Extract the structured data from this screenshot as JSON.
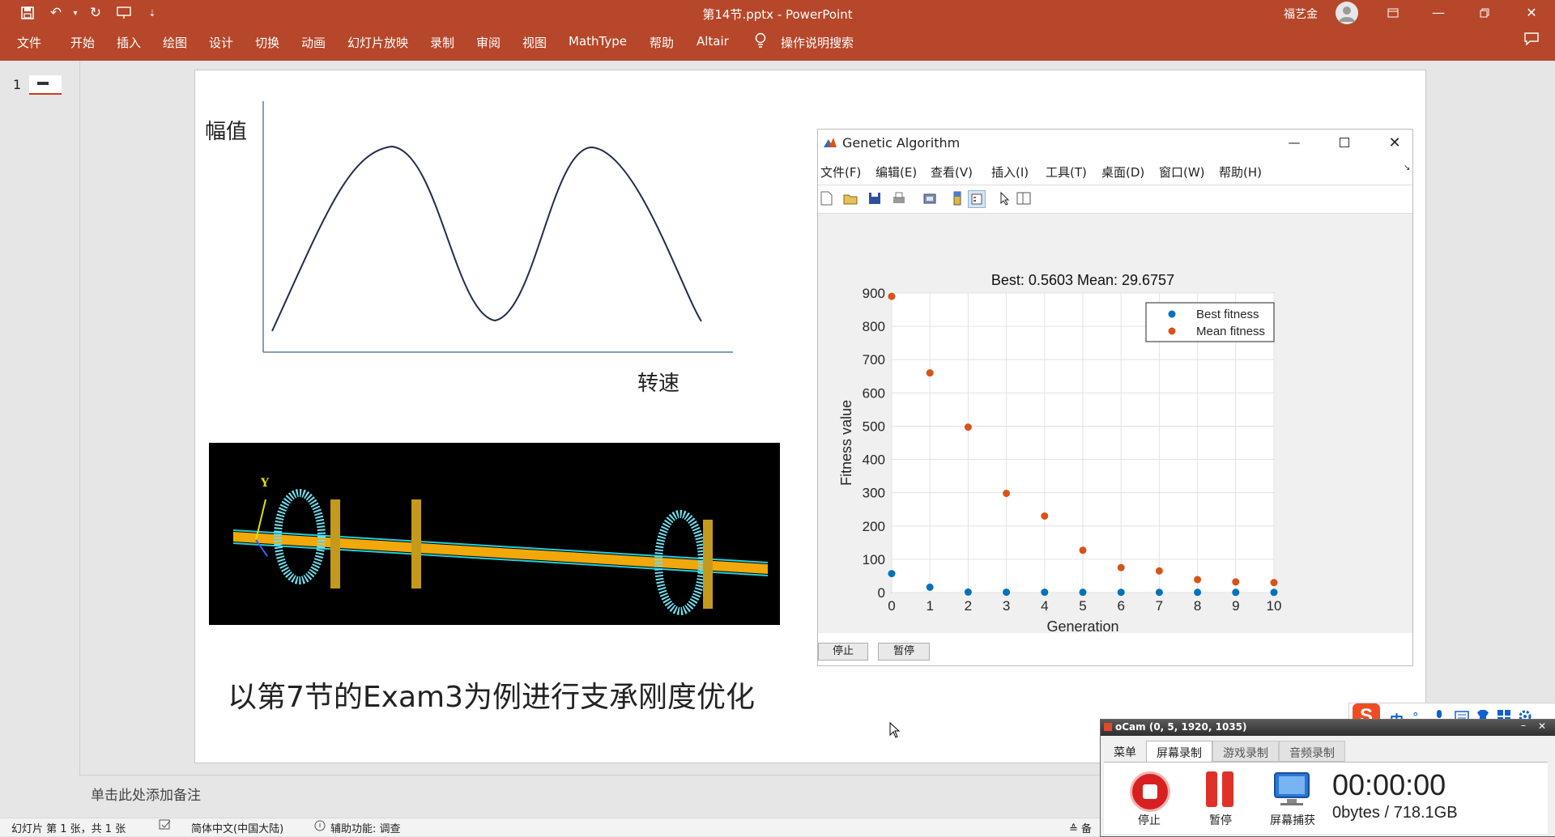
{
  "app": {
    "title": "第14节.pptx - PowerPoint",
    "user": "福艺金"
  },
  "ribbon": {
    "tabs": [
      "文件",
      "开始",
      "插入",
      "绘图",
      "设计",
      "切换",
      "动画",
      "幻灯片放映",
      "录制",
      "审阅",
      "视图",
      "MathType",
      "帮助",
      "Altair"
    ],
    "search_label": "操作说明搜索"
  },
  "thumbnail": {
    "number": "1"
  },
  "slide": {
    "curve_ylabel": "幅值",
    "curve_xlabel": "转速",
    "caption": "以第7节的Exam3为例进行支承刚度优化",
    "fe_labels": {
      "y_axis": "Y"
    }
  },
  "matlab": {
    "window_title": "Genetic Algorithm",
    "menu": [
      "文件(F)",
      "编辑(E)",
      "查看(V)",
      "插入(I)",
      "工具(T)",
      "桌面(D)",
      "窗口(W)",
      "帮助(H)"
    ],
    "stop_button": "停止",
    "pause_button": "暂停"
  },
  "chart_data": {
    "type": "scatter",
    "title": "Best: 0.5603 Mean: 29.6757",
    "xlabel": "Generation",
    "ylabel": "Fitness value",
    "xlim": [
      0,
      10
    ],
    "ylim": [
      0,
      900
    ],
    "xticks": [
      0,
      1,
      2,
      3,
      4,
      5,
      6,
      7,
      8,
      9,
      10
    ],
    "yticks": [
      0,
      100,
      200,
      300,
      400,
      500,
      600,
      700,
      800,
      900
    ],
    "grid": true,
    "legend_position": "top-right",
    "x": [
      0,
      1,
      2,
      3,
      4,
      5,
      6,
      7,
      8,
      9,
      10
    ],
    "series": [
      {
        "name": "Best fitness",
        "color": "#0072bd",
        "values": [
          57,
          16,
          1.5,
          1,
          1,
          0.8,
          0.7,
          0.6,
          0.6,
          0.56,
          0.56
        ]
      },
      {
        "name": "Mean fitness",
        "color": "#d95319",
        "values": [
          890,
          660,
          497,
          298,
          230,
          127,
          75,
          65,
          39,
          32,
          30
        ]
      }
    ]
  },
  "notes": {
    "placeholder": "单击此处添加备注"
  },
  "status": {
    "slide_info": "幻灯片 第 1 张，共 1 张",
    "language": "简体中文(中国大陆)",
    "accessibility": "辅助功能: 调查",
    "notes_short": "备"
  },
  "ocam": {
    "title": "oCam (0, 5, 1920, 1035)",
    "tabs": [
      "菜单",
      "屏幕录制",
      "游戏录制",
      "音频录制"
    ],
    "buttons": [
      "停止",
      "暂停",
      "屏幕捕获"
    ],
    "timer": "00:00:00",
    "size": "0bytes / 718.1GB"
  },
  "ime": {
    "mode": "中"
  }
}
